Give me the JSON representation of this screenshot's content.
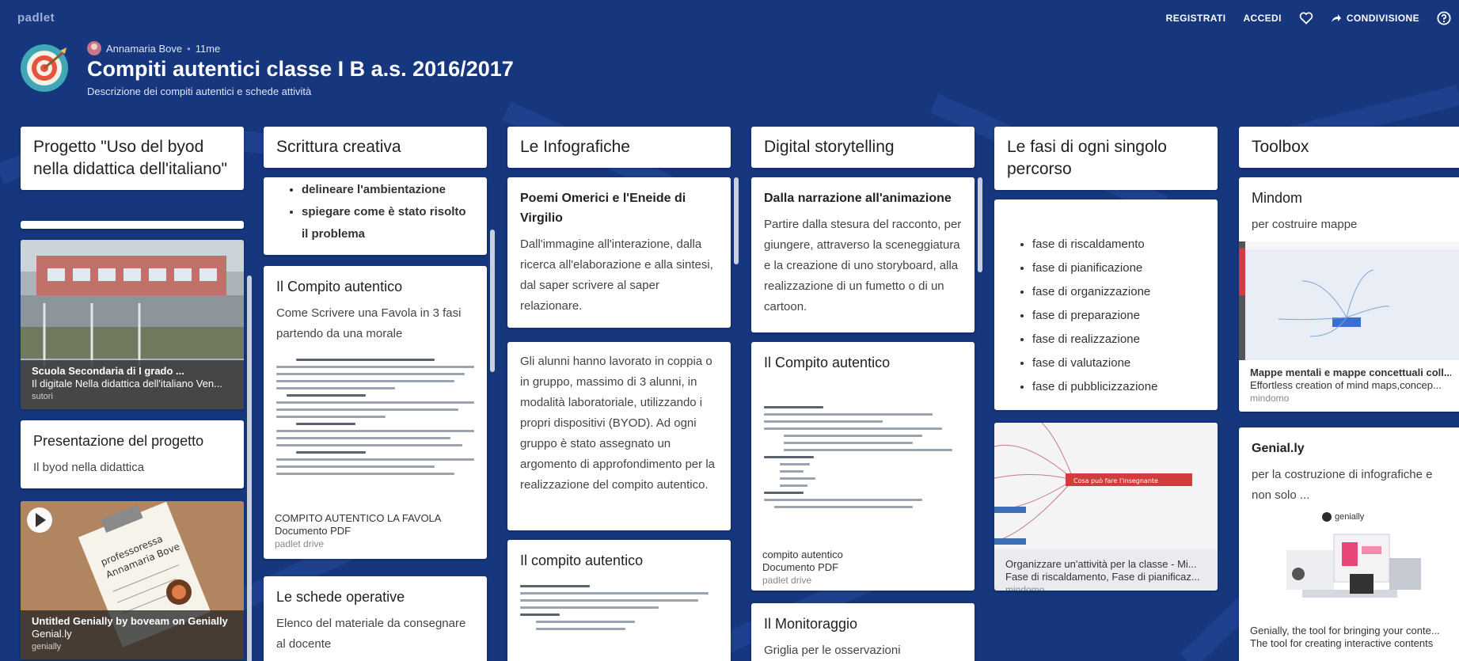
{
  "app": {
    "brand": "padlet"
  },
  "topnav": {
    "register": "REGISTRATI",
    "login": "ACCEDI",
    "share": "CONDIVISIONE"
  },
  "header": {
    "author": "Annamaria Bove",
    "time": "11me",
    "title": "Compiti autentici classe I B a.s. 2016/2017",
    "description": "Descrizione dei compiti autentici e schede attività"
  },
  "columns": [
    {
      "title": "Progetto \"Uso del  byod nella didattica dell'italiano\"",
      "school_card": {
        "title": "Scuola Secondaria di I grado ...",
        "subtitle": "Il digitale Nella didattica dell'italiano Ven...",
        "source": "sutori"
      },
      "presentation": {
        "title": "Presentazione del progetto",
        "body": "Il byod nella didattica"
      },
      "genially_card": {
        "title": "Untitled Genially by boveam on Genially",
        "subtitle": "Genial.ly",
        "source": "genially",
        "note_line1": "professoressa",
        "note_line2": "Annamaria Bove"
      }
    },
    {
      "title": "Scrittura creativa",
      "bullets": [
        "delineare l'ambientazione",
        "spiegare come è stato risolto il problema"
      ],
      "compito": {
        "title": "Il Compito autentico",
        "body": "Come Scrivere una Favola in 3 fasi partendo da una morale",
        "file": "COMPITO AUTENTICO LA FAVOLA",
        "type": "Documento PDF",
        "source": "padlet drive"
      },
      "schede": {
        "title": "Le schede operative",
        "body": "Elenco del materiale da consegnare al docente"
      }
    },
    {
      "title": "Le Infografiche",
      "poemi": {
        "title": "Poemi Omerici e l'Eneide di Virgilio",
        "body": "Dall'immagine all'interazione, dalla ricerca all'elaborazione e alla sintesi, dal saper scrivere al saper relazionare."
      },
      "alunni": {
        "body": "Gli alunni hanno lavorato in coppia o in gruppo, massimo di 3 alunni, in modalità laboratoriale, utilizzando i propri dispositivi (BYOD). Ad ogni gruppo è stato assegnato un argomento di approfondimento per la realizzazione del compito autentico."
      },
      "compito": {
        "title": "Il compito autentico"
      }
    },
    {
      "title": "Digital storytelling",
      "narrazione": {
        "title": "Dalla narrazione all'animazione",
        "body": "Partire dalla stesura del racconto, per giungere, attraverso la sceneggiatura e la creazione di uno storyboard, alla realizzazione di un fumetto o di un cartoon."
      },
      "compito": {
        "title": "Il Compito autentico",
        "file": "compito autentico",
        "type": "Documento PDF",
        "source": "padlet drive"
      },
      "monitoraggio": {
        "title": "Il Monitoraggio",
        "body": "Griglia per le osservazioni"
      }
    },
    {
      "title": "Le fasi di ogni singolo percorso",
      "phases": [
        "fase di riscaldamento",
        "fase di pianificazione",
        "fase di organizzazione",
        "fase di preparazione",
        "fase di realizzazione",
        "fase di valutazione",
        "fase di pubblicizzazione"
      ],
      "mindmap": {
        "title": "Organizzare un'attività per la classe - Mi...",
        "subtitle": "Fase di riscaldamento, Fase di pianificaz...",
        "source": "mindomo",
        "node_text": "Cosa può fare l'insegnante"
      }
    },
    {
      "title": "Toolbox",
      "mindom": {
        "title": "Mindom",
        "body": "per costruire mappe",
        "link_title": "Mappe mentali e mappe concettuali coll...",
        "link_subtitle": "Effortless creation of mind maps,concep...",
        "source": "mindomo"
      },
      "genially": {
        "title": "Genial.ly",
        "body": "per la costruzione di infografiche e non solo ...",
        "logo": "genially",
        "link_title": "Genially, the tool for bringing your conte...",
        "link_subtitle": "The tool for creating interactive contents"
      }
    }
  ],
  "colors": {
    "background": "#16367e",
    "card": "#ffffff"
  }
}
